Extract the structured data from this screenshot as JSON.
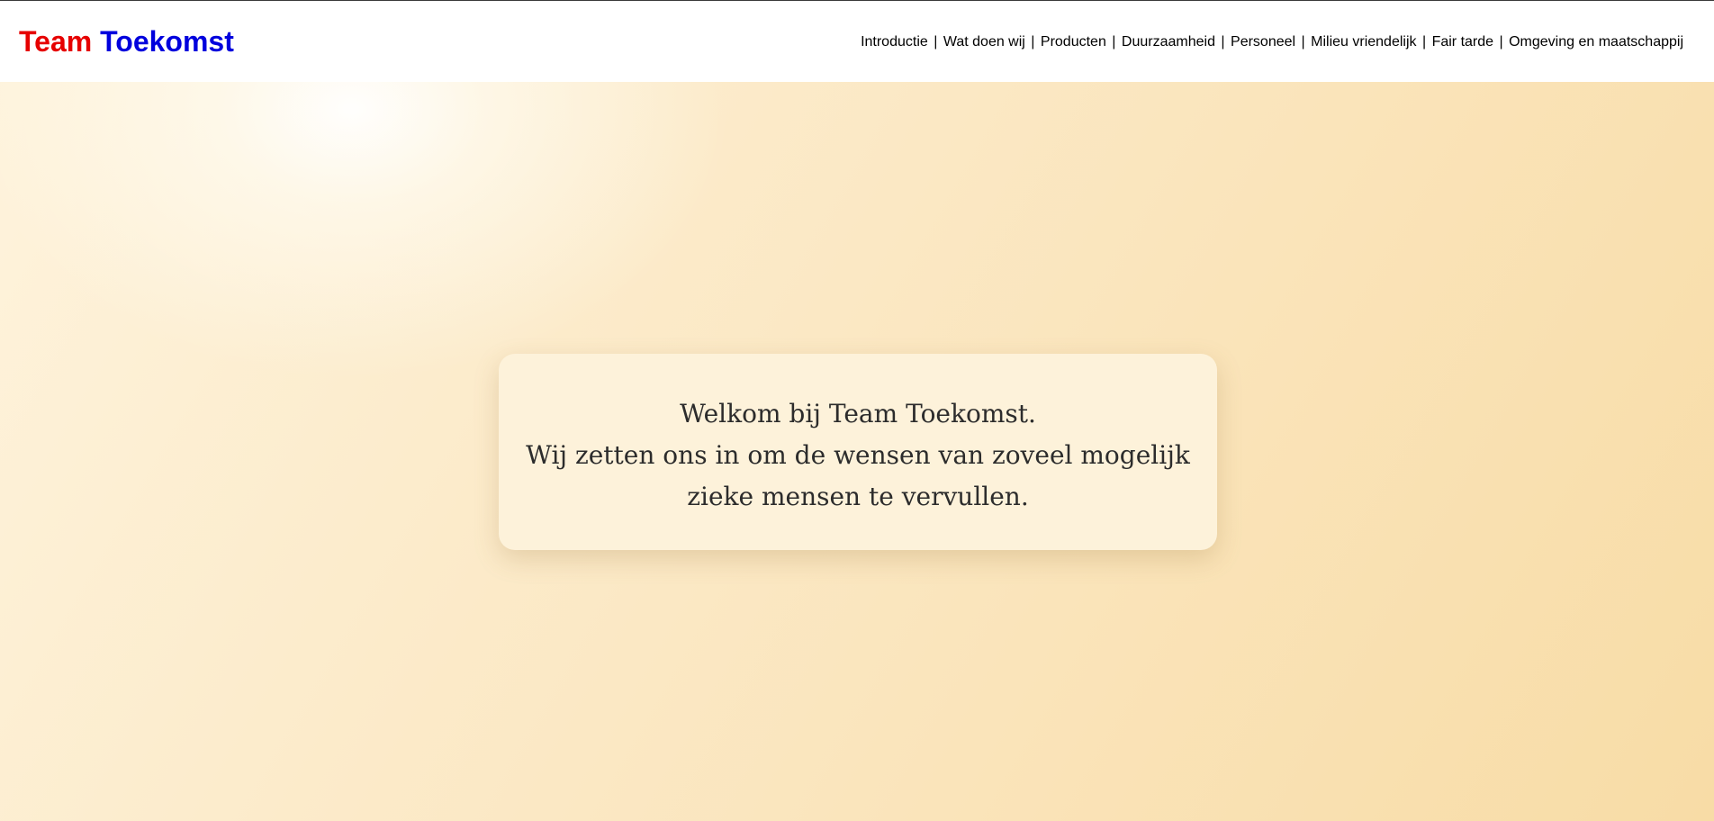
{
  "header": {
    "logo_word1": "Team",
    "logo_word2": "Toekomst",
    "logo_colors": {
      "team": "#e60000",
      "toekomst": "#0000dd"
    },
    "nav_separator": "|",
    "nav_items": [
      "Introductie",
      "Wat doen wij",
      "Producten",
      "Duurzaamheid",
      "Personeel",
      "Milieu vriendelijk",
      "Fair tarde",
      "Omgeving en maatschappij"
    ]
  },
  "hero": {
    "line1": "Welkom bij Team Toekomst.",
    "line2": "Wij zetten ons in om de wensen van zoveel mogelijk",
    "line3": "zieke mensen te vervullen."
  }
}
